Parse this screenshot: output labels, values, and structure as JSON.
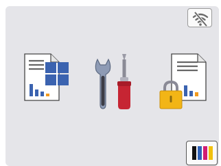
{
  "screen": {
    "background": "#e5e5e9"
  },
  "status": {
    "wifi_state": "disconnected",
    "wifi_icon": "wifi-off-icon"
  },
  "apps": [
    {
      "id": "copy",
      "icon": "copy-icon"
    },
    {
      "id": "settings",
      "icon": "settings-tools-icon"
    },
    {
      "id": "secure_print",
      "icon": "secure-print-icon"
    }
  ],
  "ink": {
    "icon": "ink-cartridge-icon",
    "colors": [
      "#111111",
      "#2f62b8",
      "#d11d73",
      "#f1c10f"
    ]
  }
}
